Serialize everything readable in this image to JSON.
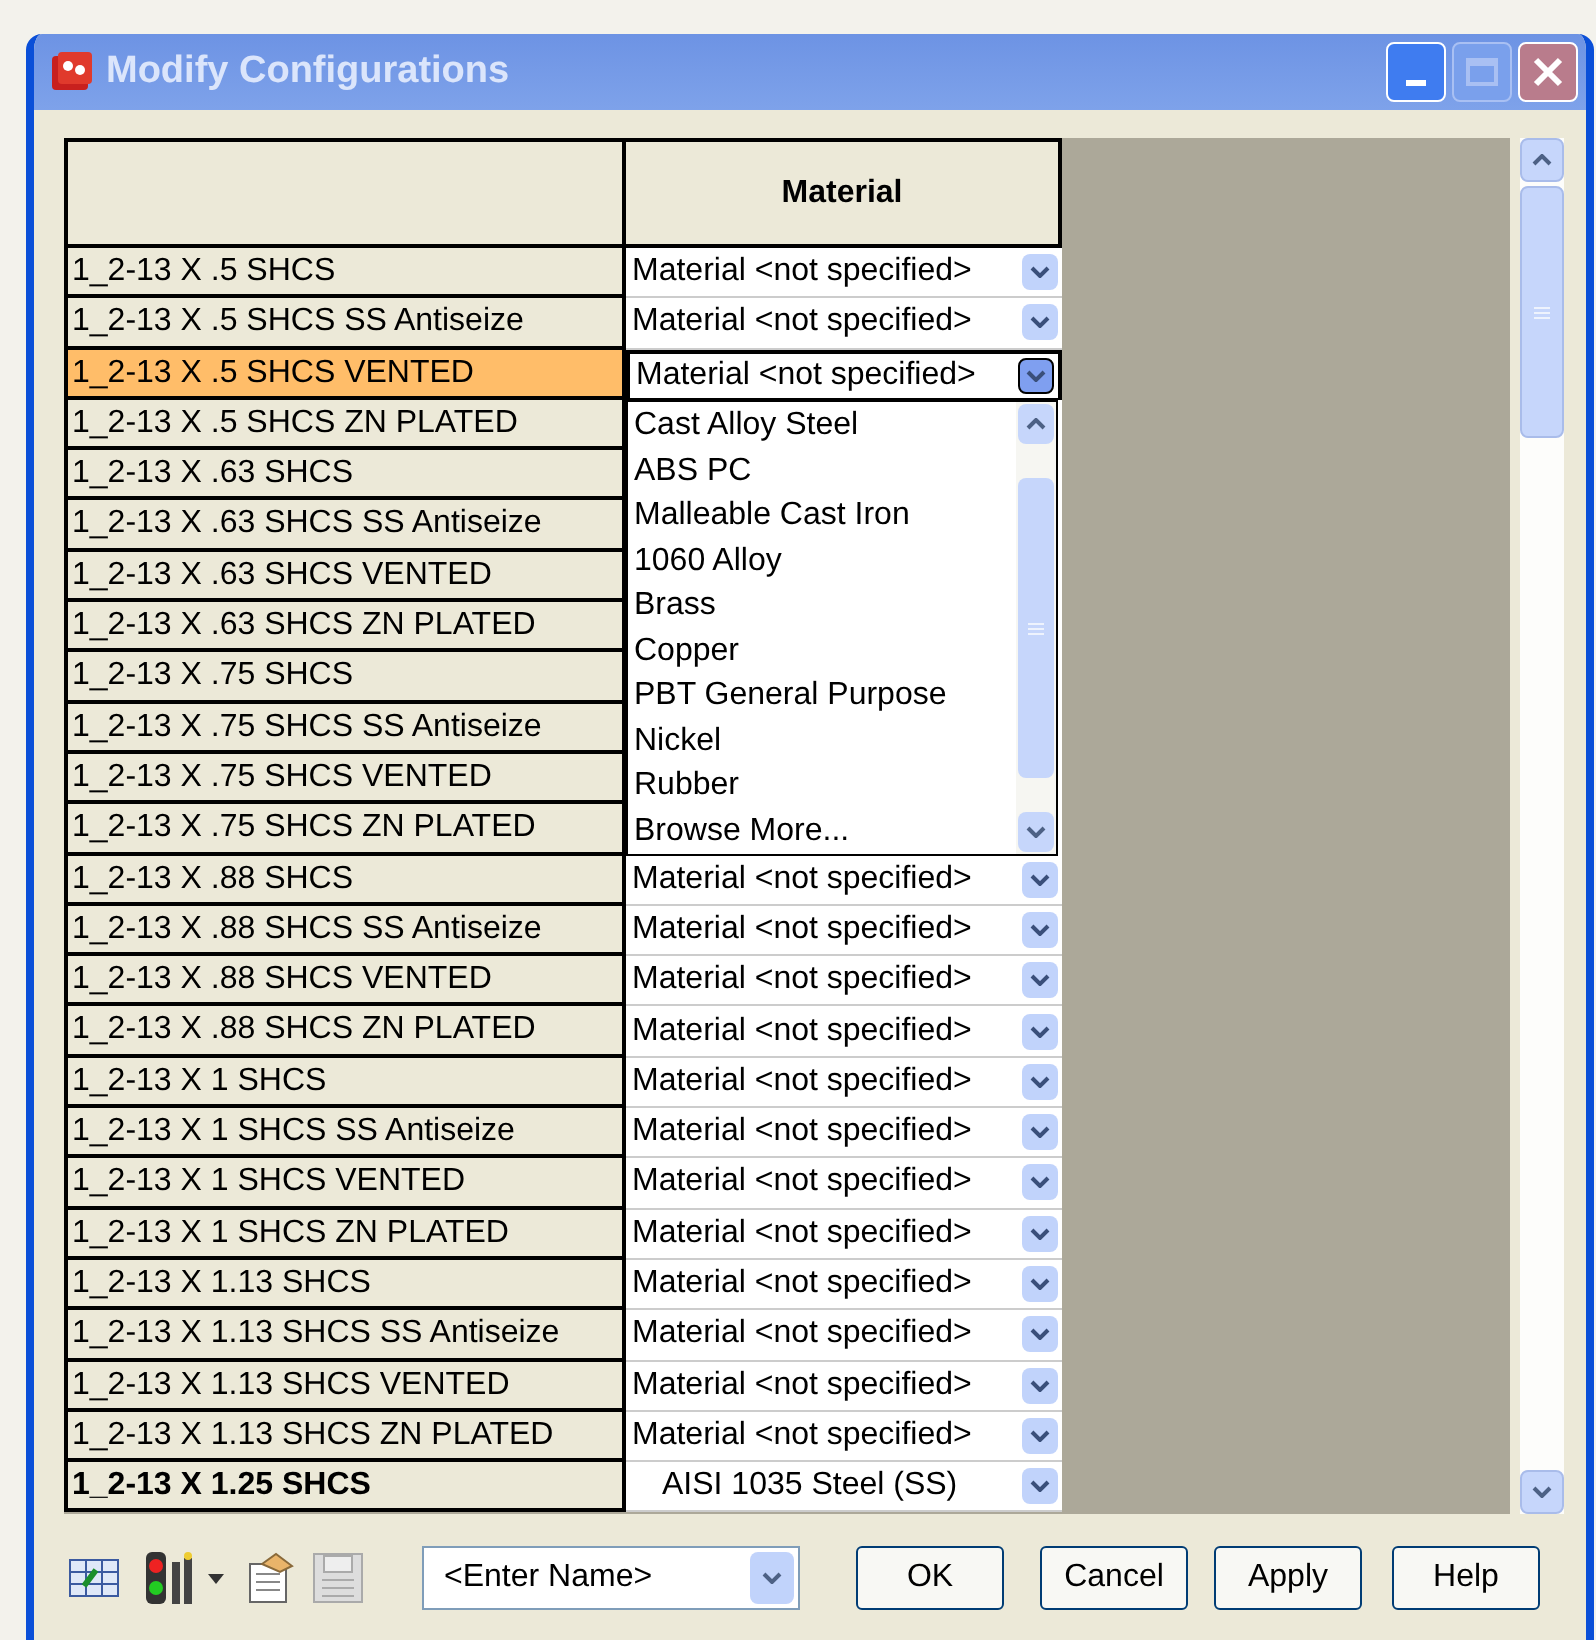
{
  "window": {
    "title": "Modify Configurations"
  },
  "table": {
    "columns": [
      "Material"
    ],
    "rows": [
      {
        "name": "1_2-13 X .5 SHCS",
        "material": "Material <not specified>",
        "selected": false,
        "bold": false
      },
      {
        "name": "1_2-13 X .5 SHCS SS Antiseize",
        "material": "Material <not specified>",
        "selected": false,
        "bold": false
      },
      {
        "name": "1_2-13 X .5 SHCS VENTED",
        "material": "Material <not specified>",
        "selected": true,
        "bold": false
      },
      {
        "name": "1_2-13 X .5 SHCS ZN PLATED",
        "selected": false,
        "bold": false
      },
      {
        "name": "1_2-13 X .63 SHCS",
        "selected": false,
        "bold": false
      },
      {
        "name": "1_2-13 X .63 SHCS SS Antiseize",
        "selected": false,
        "bold": false
      },
      {
        "name": "1_2-13 X .63 SHCS VENTED",
        "selected": false,
        "bold": false
      },
      {
        "name": "1_2-13 X .63 SHCS ZN PLATED",
        "selected": false,
        "bold": false
      },
      {
        "name": "1_2-13 X .75 SHCS",
        "selected": false,
        "bold": false
      },
      {
        "name": "1_2-13 X .75 SHCS SS Antiseize",
        "selected": false,
        "bold": false
      },
      {
        "name": "1_2-13 X .75 SHCS VENTED",
        "selected": false,
        "bold": false
      },
      {
        "name": "1_2-13 X .75 SHCS ZN PLATED",
        "selected": false,
        "bold": false
      },
      {
        "name": "1_2-13 X .88 SHCS",
        "material": "Material <not specified>",
        "selected": false,
        "bold": false
      },
      {
        "name": "1_2-13 X .88 SHCS SS Antiseize",
        "material": "Material <not specified>",
        "selected": false,
        "bold": false
      },
      {
        "name": "1_2-13 X .88 SHCS VENTED",
        "material": "Material <not specified>",
        "selected": false,
        "bold": false
      },
      {
        "name": "1_2-13 X .88 SHCS ZN PLATED",
        "material": "Material <not specified>",
        "selected": false,
        "bold": false
      },
      {
        "name": "1_2-13 X 1 SHCS",
        "material": "Material <not specified>",
        "selected": false,
        "bold": false
      },
      {
        "name": "1_2-13 X 1 SHCS SS Antiseize",
        "material": "Material <not specified>",
        "selected": false,
        "bold": false
      },
      {
        "name": "1_2-13 X 1 SHCS VENTED",
        "material": "Material <not specified>",
        "selected": false,
        "bold": false
      },
      {
        "name": "1_2-13 X 1 SHCS ZN PLATED",
        "material": "Material <not specified>",
        "selected": false,
        "bold": false
      },
      {
        "name": "1_2-13 X 1.13 SHCS",
        "material": "Material <not specified>",
        "selected": false,
        "bold": false
      },
      {
        "name": "1_2-13 X 1.13 SHCS SS Antiseize",
        "material": "Material <not specified>",
        "selected": false,
        "bold": false
      },
      {
        "name": "1_2-13 X 1.13 SHCS VENTED",
        "material": "Material <not specified>",
        "selected": false,
        "bold": false
      },
      {
        "name": "1_2-13 X 1.13 SHCS ZN PLATED",
        "material": "Material <not specified>",
        "selected": false,
        "bold": false
      },
      {
        "name": "1_2-13 X 1.25 SHCS",
        "material": "AISI 1035 Steel (SS)",
        "selected": false,
        "bold": true
      }
    ]
  },
  "dropdown": {
    "items": [
      "Cast Alloy Steel",
      "ABS PC",
      "Malleable Cast Iron",
      "1060 Alloy",
      "Brass",
      "Copper",
      "PBT General Purpose",
      "Nickel",
      "Rubber",
      "Browse More..."
    ]
  },
  "name_field": {
    "placeholder": "<Enter Name>"
  },
  "buttons": [
    "OK",
    "Cancel",
    "Apply",
    "Help"
  ]
}
